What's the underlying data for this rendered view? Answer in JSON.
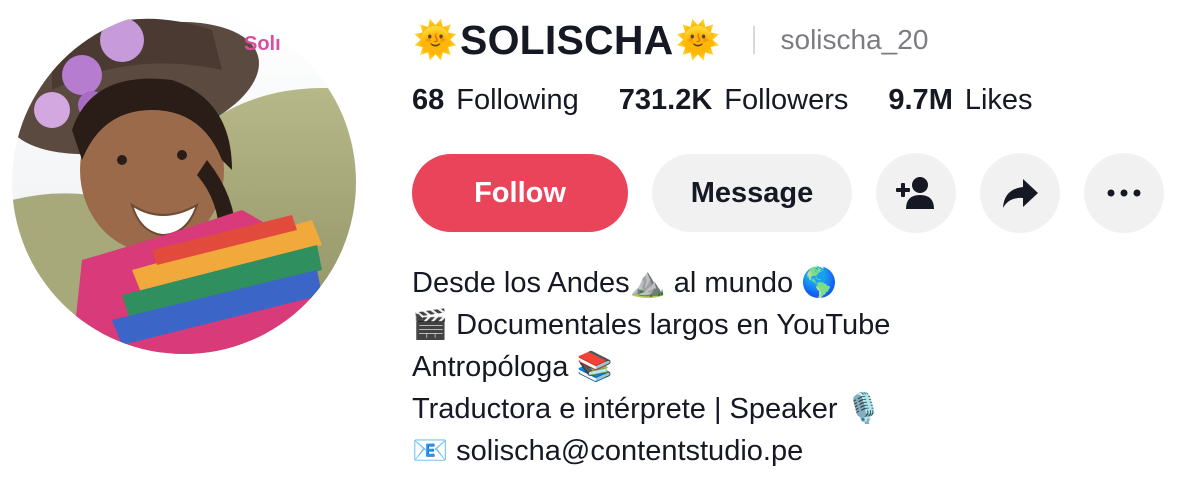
{
  "profile": {
    "display_name": "SOLISCHA",
    "name_emoji_left": "🌞",
    "name_emoji_right": "🌞",
    "username": "solischa_20",
    "avatar_overlay_text": "Soli"
  },
  "stats": [
    {
      "value": "68",
      "label": "Following"
    },
    {
      "value": "731.2K",
      "label": "Followers"
    },
    {
      "value": "9.7M",
      "label": "Likes"
    }
  ],
  "actions": {
    "follow_label": "Follow",
    "message_label": "Message",
    "add_friend_icon": "add-user-icon",
    "share_icon": "share-arrow-icon",
    "more_icon": "more-dots-icon"
  },
  "bio": [
    "Desde los Andes⛰️ al mundo 🌎",
    "🎬 Documentales largos en YouTube",
    "Antropóloga 📚",
    "Traductora e intérprete | Speaker 🎙️",
    "📧 solischa@contentstudio.pe"
  ],
  "colors": {
    "follow_bg": "#ea445a",
    "button_bg": "#f1f1f2",
    "text_primary": "#161823",
    "text_secondary": "#7b7c82"
  }
}
